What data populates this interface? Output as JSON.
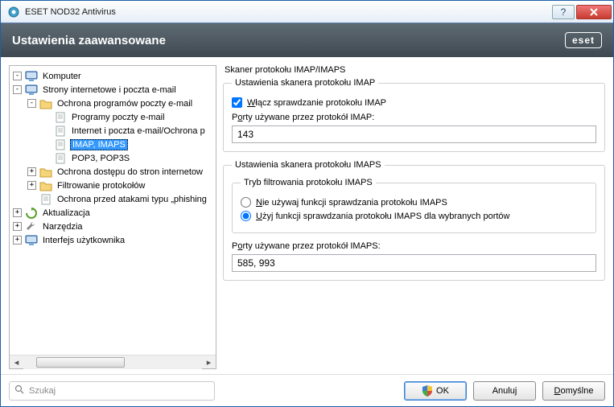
{
  "window": {
    "title": "ESET NOD32 Antivirus"
  },
  "header": {
    "title": "Ustawienia zaawansowane",
    "logo": "eset"
  },
  "tree": {
    "items": [
      {
        "level": 0,
        "exp": "-",
        "icon": "monitor",
        "label": "Komputer"
      },
      {
        "level": 0,
        "exp": "-",
        "icon": "monitor",
        "label": "Strony internetowe i poczta e-mail"
      },
      {
        "level": 1,
        "exp": "-",
        "icon": "folder",
        "label": "Ochrona programów poczty e-mail"
      },
      {
        "level": 2,
        "exp": "",
        "icon": "page",
        "label": "Programy poczty e-mail"
      },
      {
        "level": 2,
        "exp": "",
        "icon": "page",
        "label": "Internet i poczta e-mail/Ochrona p"
      },
      {
        "level": 2,
        "exp": "",
        "icon": "page",
        "label": "IMAP, IMAPS",
        "selected": true
      },
      {
        "level": 2,
        "exp": "",
        "icon": "page",
        "label": "POP3, POP3S"
      },
      {
        "level": 1,
        "exp": "+",
        "icon": "folder",
        "label": "Ochrona dostępu do stron internetow"
      },
      {
        "level": 1,
        "exp": "+",
        "icon": "folder",
        "label": "Filtrowanie protokołów"
      },
      {
        "level": 1,
        "exp": "",
        "icon": "page",
        "label": "Ochrona przed atakami typu „phishing"
      },
      {
        "level": 0,
        "exp": "+",
        "icon": "update",
        "label": "Aktualizacja"
      },
      {
        "level": 0,
        "exp": "+",
        "icon": "tools",
        "label": "Narzędzia"
      },
      {
        "level": 0,
        "exp": "+",
        "icon": "monitor",
        "label": "Interfejs użytkownika"
      }
    ]
  },
  "content": {
    "scanner_title": "Skaner protokołu IMAP/IMAPS",
    "imap": {
      "legend": "Ustawienia skanera protokołu IMAP",
      "enable_label": "Włącz sprawdzanie protokołu IMAP",
      "enable_accel": "W",
      "enable_checked": true,
      "ports_label": "Porty używane przez protokół IMAP:",
      "ports_accel": "o",
      "ports_value": "143"
    },
    "imaps": {
      "legend": "Ustawienia skanera protokołu IMAPS",
      "filter_legend": "Tryb filtrowania protokołu IMAPS",
      "opt_none": "Nie używaj funkcji sprawdzania protokołu IMAPS",
      "opt_none_accel": "N",
      "opt_selected": "Użyj funkcji sprawdzania protokołu IMAPS dla wybranych portów",
      "opt_selected_accel": "U",
      "choice": "selected",
      "ports_label": "Porty używane przez protokół IMAPS:",
      "ports_accel": "o",
      "ports_value": "585, 993"
    }
  },
  "footer": {
    "search_placeholder": "Szukaj",
    "ok": "OK",
    "cancel": "Anuluj",
    "default": "Domyślne",
    "default_accel": "D"
  }
}
